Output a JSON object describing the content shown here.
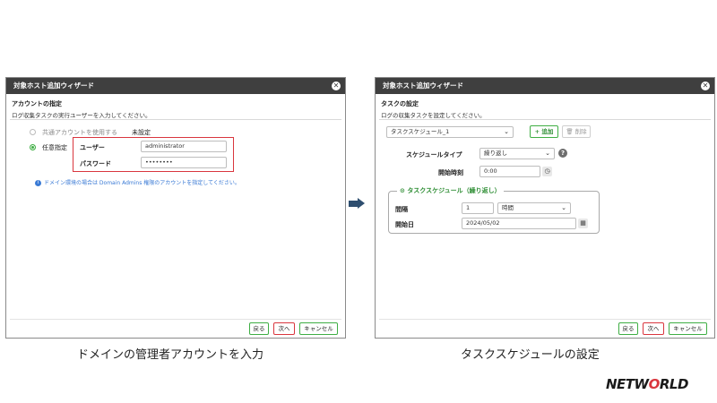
{
  "left_dialog": {
    "title": "対象ホスト追加ウィザード",
    "section_title": "アカウントの指定",
    "section_desc": "ログ収集タスクの実行ユーザーを入力してください。",
    "option_shared": "共通アカウントを使用する",
    "option_shared_value": "未設定",
    "option_custom": "任意指定",
    "user_label": "ユーザー",
    "user_value": "administrator",
    "password_label": "パスワード",
    "password_value": "••••••••",
    "info_text": "ドメイン環境の場合は Domain Admins 権限のアカウントを指定してください。",
    "back_label": "戻る",
    "next_label": "次へ",
    "cancel_label": "キャンセル"
  },
  "right_dialog": {
    "title": "対象ホスト追加ウィザード",
    "section_title": "タスクの設定",
    "section_desc": "ログの収集タスクを設定してください。",
    "task_select": "タスクスケジュール_1",
    "add_label": "追加",
    "delete_label": "削除",
    "schedule_type_label": "スケジュールタイプ",
    "schedule_type_value": "繰り返し",
    "start_time_label": "開始時刻",
    "start_time_value": "0:00",
    "fieldset_legend": "タスクスケジュール（繰り返し）",
    "interval_label": "間隔",
    "interval_value": "1",
    "interval_unit": "時間",
    "start_date_label": "開始日",
    "start_date_value": "2024/05/02",
    "back_label": "戻る",
    "next_label": "次へ",
    "cancel_label": "キャンセル"
  },
  "captions": {
    "left": "ドメインの管理者アカウントを入力",
    "right": "タスクスケジュールの設定"
  },
  "logo": {
    "text_a": "NETW",
    "text_o": "O",
    "text_b": "RLD"
  },
  "colors": {
    "accent_green": "#3fae44",
    "highlight_red": "#d9363e",
    "titlebar": "#3f3f3f",
    "arrow": "#2e4e6f"
  }
}
